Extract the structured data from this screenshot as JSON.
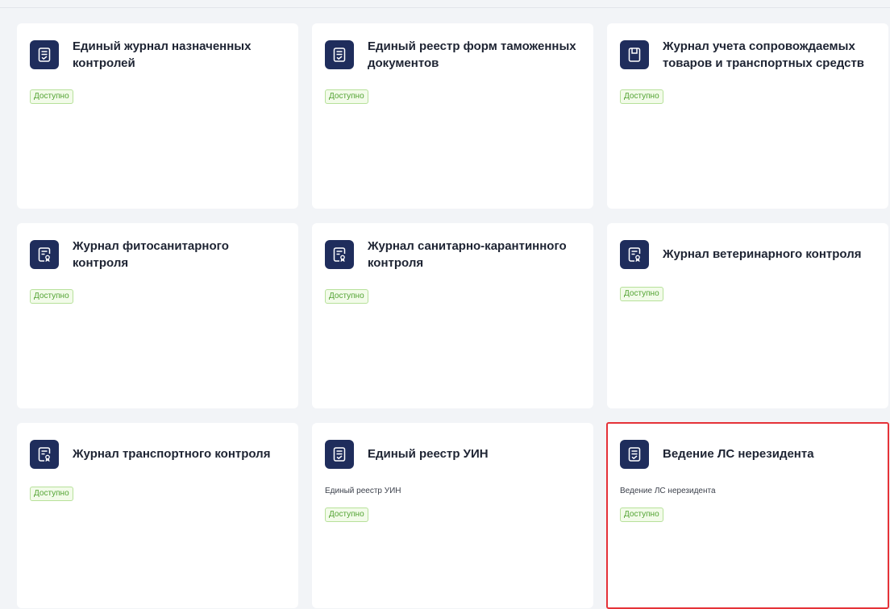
{
  "colors": {
    "icon_bg": "#1f2d5c",
    "badge_text": "#52a332",
    "badge_border": "#b7e19a",
    "selection": "#e53238"
  },
  "cards": [
    {
      "title": "Единый журнал назначенных контролей",
      "desc": "",
      "status": "Доступно",
      "icon": "document-check-icon"
    },
    {
      "title": "Единый реестр форм таможенных документов",
      "desc": "",
      "status": "Доступно",
      "icon": "document-check-icon"
    },
    {
      "title": "Журнал учета сопровождаемых товаров и транспортных средств",
      "desc": "",
      "status": "Доступно",
      "icon": "document-folded-icon"
    },
    {
      "title": "Журнал фитосанитарного контроля",
      "desc": "",
      "status": "Доступно",
      "icon": "document-certificate-icon"
    },
    {
      "title": "Журнал санитарно-карантинного контроля",
      "desc": "",
      "status": "Доступно",
      "icon": "document-certificate-icon"
    },
    {
      "title": "Журнал ветеринарного контроля",
      "desc": "",
      "status": "Доступно",
      "icon": "document-certificate-icon"
    },
    {
      "title": "Журнал транспортного контроля",
      "desc": "",
      "status": "Доступно",
      "icon": "document-certificate-icon"
    },
    {
      "title": "Единый реестр УИН",
      "desc": "Единый реестр УИН",
      "status": "Доступно",
      "icon": "document-check-icon"
    },
    {
      "title": "Ведение ЛС нерезидента",
      "desc": "Ведение ЛС нерезидента",
      "status": "Доступно",
      "icon": "document-check-icon",
      "selected": true
    }
  ]
}
